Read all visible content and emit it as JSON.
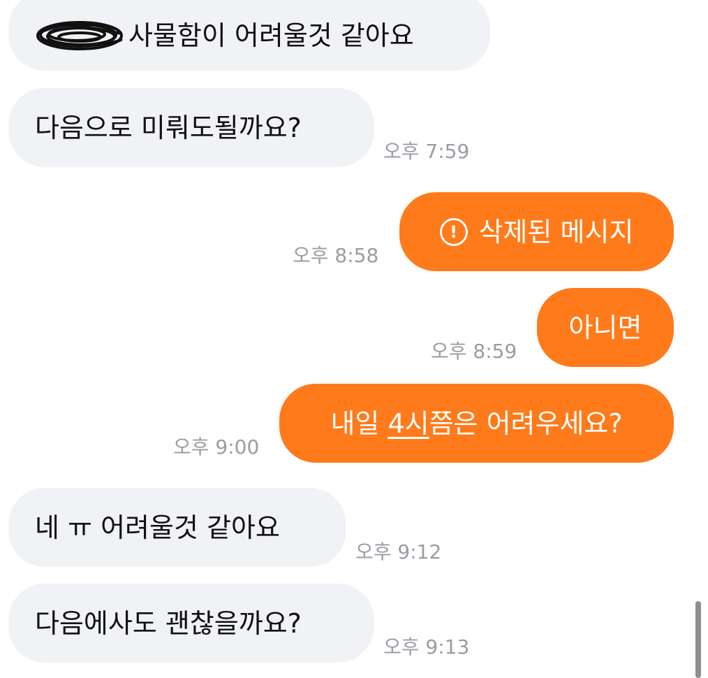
{
  "messages": [
    {
      "direction": "incoming",
      "redacted_prefix": true,
      "text": "사물함이 어려울것 같아요",
      "time": ""
    },
    {
      "direction": "incoming",
      "text": "다음으로 미뤄도될까요?",
      "time": "오후 7:59"
    },
    {
      "direction": "outgoing",
      "icon": "alert-circle-icon",
      "text": "삭제된 메시지",
      "time": "오후 8:58"
    },
    {
      "direction": "outgoing",
      "text": "아니면",
      "time": "오후 8:59"
    },
    {
      "direction": "outgoing",
      "text_parts": [
        "내일 ",
        "4시",
        "쯤은 어려우세요?"
      ],
      "underlined_part": "4시",
      "time": "오후 9:00"
    },
    {
      "direction": "incoming",
      "text": "네 ㅠ 어려울것 같아요",
      "time": "오후 9:12"
    },
    {
      "direction": "incoming",
      "text": "다음에사도 괜찮을까요?",
      "time": "오후 9:13"
    }
  ],
  "colors": {
    "incoming_bubble": "#f1f2f5",
    "outgoing_bubble": "#ff7a1a",
    "timestamp": "#9a9ca3",
    "scrollbar": "#8e8e93"
  }
}
